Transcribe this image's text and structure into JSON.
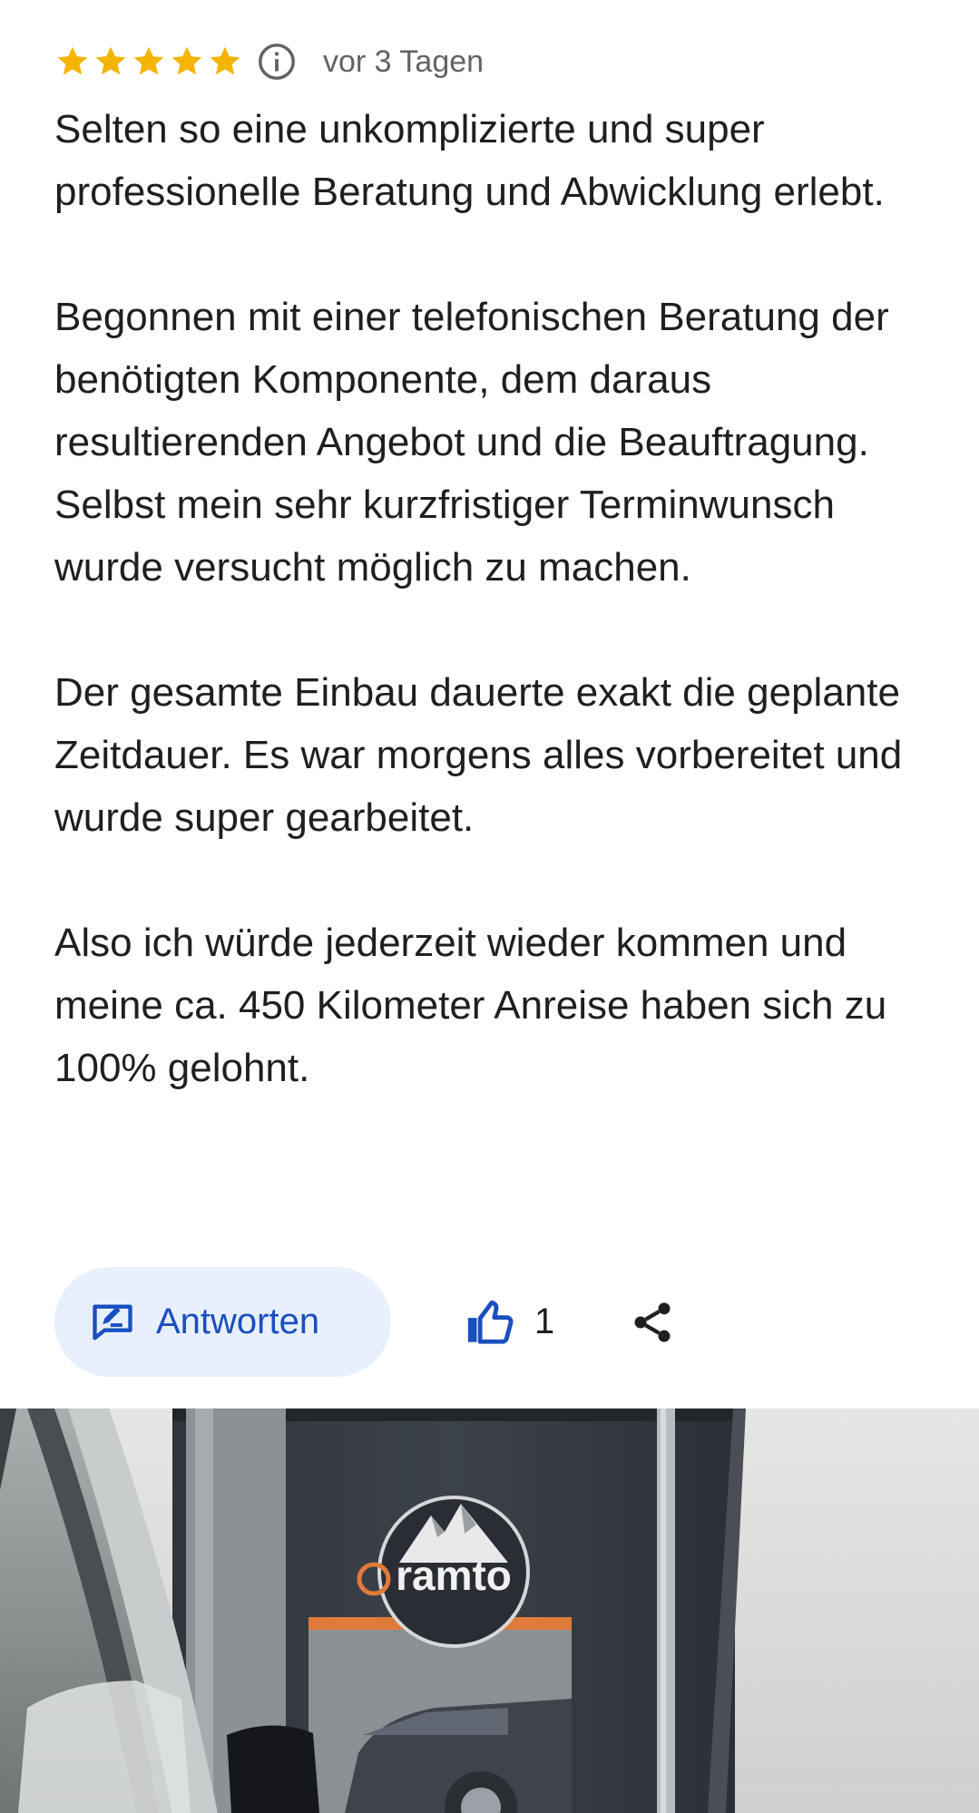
{
  "review": {
    "rating": 5,
    "rating_max": 5,
    "date": "vor 3 Tagen",
    "paragraphs": [
      "Selten so eine unkomplizierte und super professionelle Beratung und Abwicklung erlebt.",
      "Begonnen mit einer telefonischen Beratung der benötigten Komponente, dem daraus resultierenden Angebot und die Beauftragung. Selbst mein sehr kurzfristiger Terminwunsch wurde versucht möglich zu machen.",
      "Der gesamte Einbau dauerte exakt die geplante Zeitdauer. Es war morgens alles vorbereitet und wurde super gearbeitet.",
      "Also ich würde jederzeit wieder kommen und meine ca. 450 Kilometer Anreise haben sich zu 100% gelohnt."
    ]
  },
  "actions": {
    "reply_label": "Antworten",
    "like_count": "1"
  },
  "icons": {
    "star": "star-icon",
    "info": "info-icon",
    "reply": "reply-edit-icon",
    "like": "thumbs-up-icon",
    "share": "share-icon"
  },
  "photo": {
    "logo_text": "ramto"
  },
  "colors": {
    "star": "#f4b400",
    "accent": "#1a4fbf",
    "reply_bg": "#e8f0fe",
    "meta_text": "#5f6368",
    "body_text": "#1f1f1f"
  }
}
